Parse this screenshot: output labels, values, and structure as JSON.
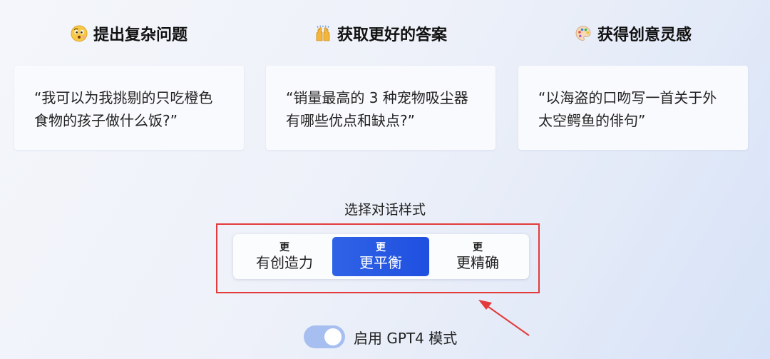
{
  "columns": [
    {
      "icon": "thinking-face-icon",
      "title": "提出复杂问题",
      "prompt": "“我可以为我挑剔的只吃橙色食物的孩子做什么饭?”"
    },
    {
      "icon": "raising-hands-icon",
      "title": "获取更好的答案",
      "prompt": "“销量最高的 3 种宠物吸尘器有哪些优点和缺点?”"
    },
    {
      "icon": "artist-palette-icon",
      "title": "获得创意灵感",
      "prompt": "“以海盗的口吻写一首关于外太空鳄鱼的俳句”"
    }
  ],
  "tone": {
    "label": "选择对话样式",
    "options": [
      {
        "prefix": "更",
        "label": "有创造力",
        "selected": false
      },
      {
        "prefix": "更",
        "label": "更平衡",
        "selected": true
      },
      {
        "prefix": "更",
        "label": "更精确",
        "selected": false
      }
    ]
  },
  "gpt4_toggle": {
    "label": "启用 GPT4 模式",
    "enabled": true
  },
  "colors": {
    "selected_tone": "#1f4fe0",
    "highlight_box": "#e33b3b",
    "toggle_track": "#a7bff0"
  }
}
